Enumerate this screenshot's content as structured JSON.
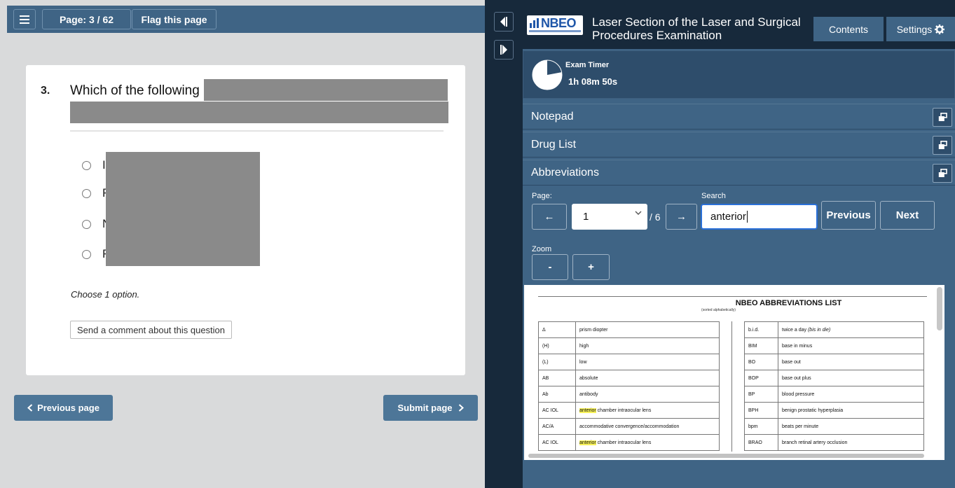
{
  "toolbar": {
    "menu_icon": "hamburger-menu-icon",
    "page_indicator": "Page: 3 / 62",
    "flag_label": "Flag this page"
  },
  "question": {
    "number": "3.",
    "text_visible": "Which of the following",
    "options": [
      {
        "letter": "I"
      },
      {
        "letter": "F"
      },
      {
        "letter": "N"
      },
      {
        "letter": "F"
      }
    ],
    "instruction": "Choose 1 option.",
    "comment_label": "Send a comment about this question"
  },
  "nav": {
    "previous_label": "Previous page",
    "submit_label": "Submit page"
  },
  "header": {
    "logo_text": "NBEO",
    "title": "Laser Section of the Laser and Surgical Procedures Examination",
    "contents_label": "Contents",
    "settings_label": "Settings"
  },
  "timer": {
    "label": "Exam Timer",
    "value": "1h 08m 50s",
    "remaining_fraction": 0.78
  },
  "panels": {
    "notepad": "Notepad",
    "drug_list": "Drug List",
    "abbreviations": "Abbreviations"
  },
  "abbr_controls": {
    "page_label": "Page:",
    "page_value": "1",
    "page_total": "/ 6",
    "search_label": "Search",
    "search_value": "anterior",
    "previous_label": "Previous",
    "next_label": "Next",
    "zoom_label": "Zoom",
    "zoom_out": "-",
    "zoom_in": "+",
    "prev_arrow": "←",
    "next_arrow": "→"
  },
  "doc": {
    "title": "NBEO ABBREVIATIONS LIST",
    "subtitle": "(sorted alphabetically)",
    "left_rows": [
      {
        "abbr": "Δ",
        "pre": "",
        "hl": "",
        "meaning": "prism diopter"
      },
      {
        "abbr": "(H)",
        "pre": "",
        "hl": "",
        "meaning": "high"
      },
      {
        "abbr": "(L)",
        "pre": "",
        "hl": "",
        "meaning": "low"
      },
      {
        "abbr": "AB",
        "pre": "",
        "hl": "",
        "meaning": "absolute"
      },
      {
        "abbr": "Ab",
        "pre": "",
        "hl": "",
        "meaning": "antibody"
      },
      {
        "abbr": "AC IOL",
        "pre": "",
        "hl": "anterior",
        "meaning": " chamber intraocular lens"
      },
      {
        "abbr": "AC/A",
        "pre": "",
        "hl": "",
        "meaning": "accommodative convergence/accommodation"
      },
      {
        "abbr": "AC IOL",
        "pre": "",
        "hl": "anterior",
        "meaning": " chamber intraocular lens"
      }
    ],
    "right_rows": [
      {
        "abbr": "b.i.d.",
        "meaning": "twice a day ",
        "italic": "(bis in die)"
      },
      {
        "abbr": "BIM",
        "meaning": "base in minus",
        "italic": ""
      },
      {
        "abbr": "BO",
        "meaning": "base out",
        "italic": ""
      },
      {
        "abbr": "BOP",
        "meaning": "base out plus",
        "italic": ""
      },
      {
        "abbr": "BP",
        "meaning": "blood pressure",
        "italic": ""
      },
      {
        "abbr": "BPH",
        "meaning": "benign prostatic hyperplasia",
        "italic": ""
      },
      {
        "abbr": "bpm",
        "meaning": "beats per minute",
        "italic": ""
      },
      {
        "abbr": "BRAO",
        "meaning": "branch retinal artery occlusion",
        "italic": ""
      }
    ]
  }
}
